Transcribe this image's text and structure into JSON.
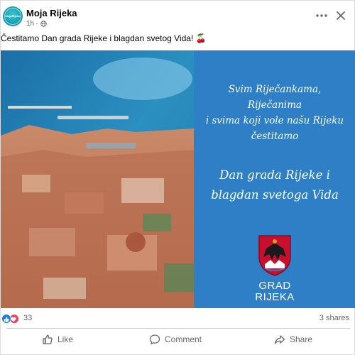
{
  "post": {
    "page_name": "Moja Rijeka",
    "avatar_text": "MojaRijeka",
    "time": "1h",
    "privacy_icon": "globe-icon",
    "more_icon": "more-icon",
    "close_icon": "close-icon",
    "text": "Čestitamo Dan grada Rijeke i blagdan svetog Vida! 🍒"
  },
  "image": {
    "greeting_lines": [
      "Svim Riječankama,",
      "Riječanima",
      "i svima koji vole našu Rijeku",
      "čestitamo"
    ],
    "title_lines": [
      "Dan grada Rijeke i",
      "blagdan svetoga Vida"
    ],
    "logo_label_lines": [
      "GRAD",
      "RIJEKA"
    ],
    "panel_color": "#2e7fc6"
  },
  "reactions": {
    "icons": [
      "like-icon",
      "love-icon"
    ],
    "count": "33",
    "shares": "3 shares"
  },
  "actions": {
    "like": "Like",
    "comment": "Comment",
    "share": "Share"
  },
  "colors": {
    "accent": "#1877f2",
    "love": "#f33e58",
    "secondary_text": "#65676b"
  }
}
